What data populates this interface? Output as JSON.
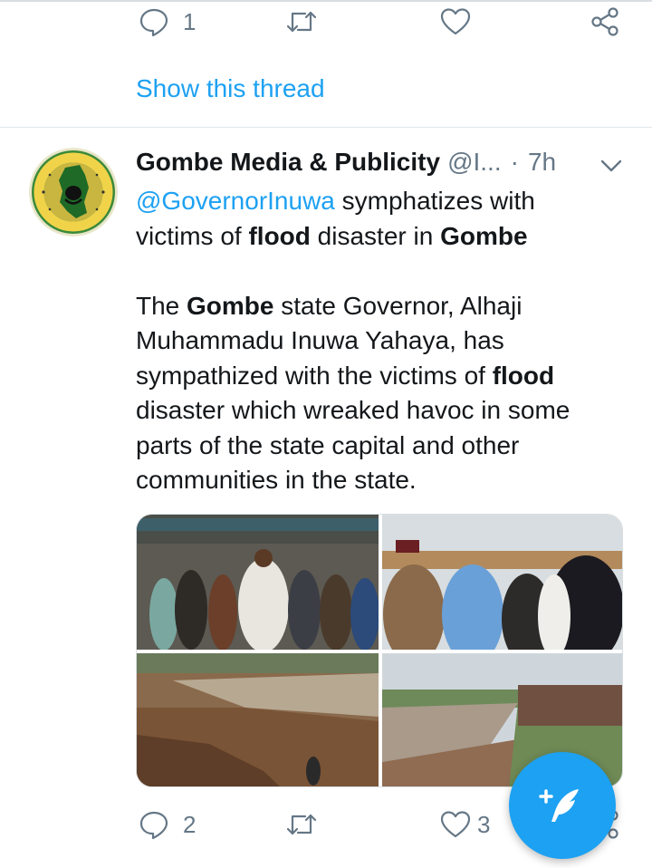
{
  "prev_tweet": {
    "reply_count": "1",
    "show_thread": "Show this thread"
  },
  "tweet": {
    "author_name": "Gombe Media & Publicity",
    "handle": "@I...",
    "separator": "·",
    "time": "7h",
    "text": {
      "mention": "@GovernorInuwa",
      "line1_after_mention": " symphatizes with",
      "line2_pre": "victims of ",
      "line2_bold1": "flood",
      "line2_mid": " disaster in ",
      "line2_bold2": "Gombe",
      "p2_pre": "The ",
      "p2_bold1": "Gombe",
      "p2_mid": " state Governor, Alhaji Muhammadu Inuwa Yahaya, has sympathized with the victims of ",
      "p2_bold2": "flood",
      "p2_post": " disaster which wreaked havoc in some parts of the state capital and other communities in the state."
    },
    "reply_count": "2",
    "like_count": "3"
  },
  "colors": {
    "accent": "#1da1f2",
    "icon_gray": "#657786",
    "text": "#14171a"
  },
  "icons": [
    "reply-icon",
    "retweet-icon",
    "like-icon",
    "share-icon",
    "chevron-down-icon",
    "compose-tweet-icon"
  ]
}
